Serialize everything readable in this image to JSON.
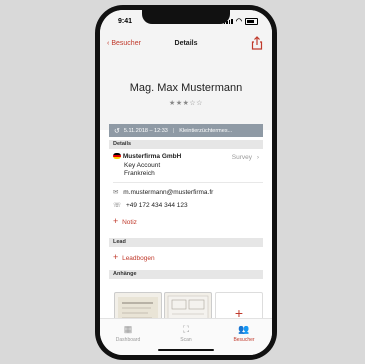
{
  "status": {
    "time": "9:41"
  },
  "nav": {
    "back": "Besucher",
    "title": "Details"
  },
  "visitor": {
    "name": "Mag. Max Mustermann",
    "rating": 3,
    "rating_max": 5
  },
  "visit": {
    "datetime": "5.11.2018 – 12:33",
    "event": "Kleintierzüchtermes..."
  },
  "details": {
    "section": "Details",
    "company": "Musterfirma GmbH",
    "company_action": "Survey",
    "role": "Key Account",
    "country": "Frankreich",
    "email": "m.mustermann@musterfirma.fr",
    "phone": "+49 172 434 344 123",
    "add_note": "Notiz"
  },
  "lead": {
    "section": "Lead",
    "add": "Leadbogen"
  },
  "attachments": {
    "section": "Anhänge"
  },
  "tabs": [
    {
      "label": "Dashboard",
      "icon": "grid-icon"
    },
    {
      "label": "Scan",
      "icon": "scan-icon"
    },
    {
      "label": "Besucher",
      "icon": "people-icon"
    }
  ],
  "colors": {
    "accent": "#c0392b",
    "visitbar": "#8f9aa5",
    "section": "#e6e6e6"
  }
}
